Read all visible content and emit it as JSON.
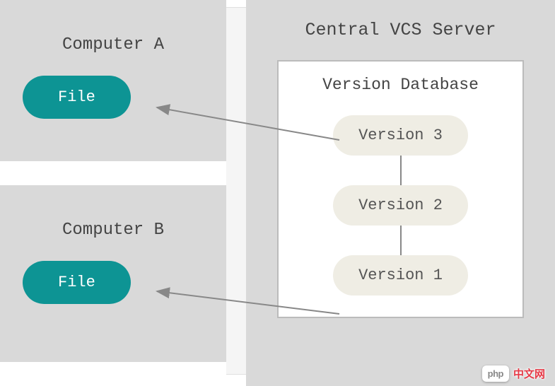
{
  "computerA": {
    "title": "Computer A",
    "file_label": "File"
  },
  "computerB": {
    "title": "Computer B",
    "file_label": "File"
  },
  "server": {
    "title": "Central VCS Server",
    "database": {
      "title": "Version Database",
      "versions": [
        "Version 3",
        "Version 2",
        "Version 1"
      ]
    }
  },
  "watermark": {
    "badge": "php",
    "text": "中文网"
  },
  "colors": {
    "box_bg": "#d9d9d9",
    "file_pill": "#0d9494",
    "version_pill": "#efede4",
    "watermark_text": "#e63946"
  }
}
